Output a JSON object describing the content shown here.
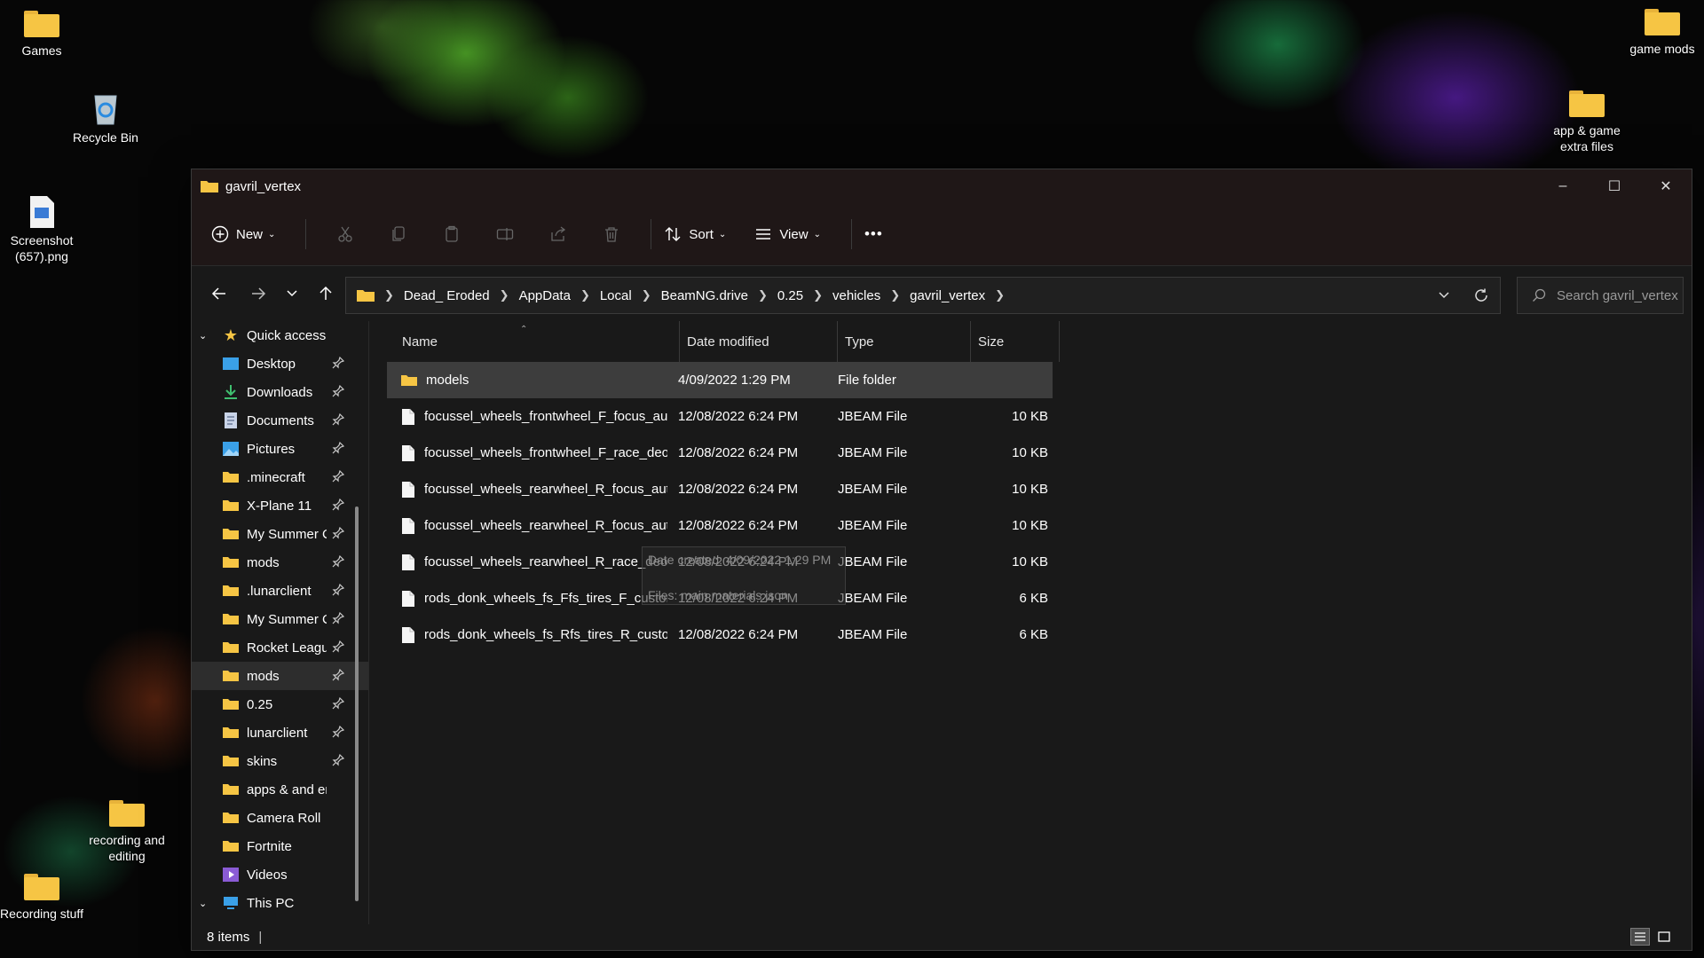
{
  "desktop": {
    "games": "Games",
    "recycle_bin": "Recycle Bin",
    "screenshot": "Screenshot (657).png",
    "game_mods": "game mods",
    "app_game_extra": "app & game extra files",
    "recording_editing": "recording and editing",
    "recording_stuff": "Recording stuff"
  },
  "window": {
    "title": "gavril_vertex",
    "controls": {
      "minimize": "–",
      "maximize": "☐",
      "close": "✕"
    }
  },
  "toolbar": {
    "new_label": "New",
    "sort_label": "Sort",
    "view_label": "View",
    "more_label": "•••"
  },
  "address": {
    "crumbs": [
      "Dead_ Eroded",
      "AppData",
      "Local",
      "BeamNG.drive",
      "0.25",
      "vehicles",
      "gavril_vertex"
    ]
  },
  "search": {
    "placeholder": "Search gavril_vertex"
  },
  "sidebar": {
    "quick_access": "Quick access",
    "items": [
      {
        "label": "Desktop",
        "icon": "desktop-icon"
      },
      {
        "label": "Downloads",
        "icon": "downloads-icon"
      },
      {
        "label": "Documents",
        "icon": "documents-icon"
      },
      {
        "label": "Pictures",
        "icon": "pictures-icon"
      },
      {
        "label": ".minecraft",
        "icon": "folder-icon"
      },
      {
        "label": "X-Plane 11",
        "icon": "folder-icon"
      },
      {
        "label": "My Summer C",
        "icon": "folder-icon"
      },
      {
        "label": "mods",
        "icon": "folder-icon"
      },
      {
        "label": ".lunarclient",
        "icon": "folder-icon"
      },
      {
        "label": "My Summer C",
        "icon": "folder-icon"
      },
      {
        "label": "Rocket Leagu",
        "icon": "folder-icon"
      },
      {
        "label": "mods",
        "icon": "folder-icon"
      },
      {
        "label": "0.25",
        "icon": "folder-icon"
      },
      {
        "label": "lunarclient",
        "icon": "folder-icon"
      },
      {
        "label": "skins",
        "icon": "folder-icon"
      },
      {
        "label": "apps & and ente",
        "icon": "folder-icon"
      },
      {
        "label": "Camera Roll",
        "icon": "folder-icon"
      },
      {
        "label": "Fortnite",
        "icon": "folder-icon"
      },
      {
        "label": "Videos",
        "icon": "videos-icon"
      }
    ],
    "this_pc": "This PC"
  },
  "columns": {
    "name": "Name",
    "date": "Date modified",
    "type": "Type",
    "size": "Size"
  },
  "files": [
    {
      "name": "models",
      "date": "4/09/2022 1:29 PM",
      "type": "File folder",
      "size": ""
    },
    {
      "name": "focussel_wheels_frontwheel_F_focus_auto...",
      "date": "12/08/2022 6:24 PM",
      "type": "JBEAM File",
      "size": "10 KB"
    },
    {
      "name": "focussel_wheels_frontwheel_F_race_deo_...",
      "date": "12/08/2022 6:24 PM",
      "type": "JBEAM File",
      "size": "10 KB"
    },
    {
      "name": "focussel_wheels_rearwheel_R_focus_auto_...",
      "date": "12/08/2022 6:24 PM",
      "type": "JBEAM File",
      "size": "10 KB"
    },
    {
      "name": "focussel_wheels_rearwheel_R_focus_auto_...",
      "date": "12/08/2022 6:24 PM",
      "type": "JBEAM File",
      "size": "10 KB"
    },
    {
      "name": "focussel_wheels_rearwheel_R_race_deo_a...",
      "date": "12/08/2022 6:24 PM",
      "type": "JBEAM File",
      "size": "10 KB"
    },
    {
      "name": "rods_donk_wheels_fs_Ffs_tires_F_customiz...",
      "date": "12/08/2022 6:24 PM",
      "type": "JBEAM File",
      "size": "6 KB"
    },
    {
      "name": "rods_donk_wheels_fs_Rfs_tires_R_customi...",
      "date": "12/08/2022 6:24 PM",
      "type": "JBEAM File",
      "size": "6 KB"
    }
  ],
  "tooltip": {
    "line1": "Date created: 4/09/2022 1:29 PM",
    "line2": "Files: main.materials.json"
  },
  "status": {
    "count": "8 items",
    "caret": "|"
  }
}
